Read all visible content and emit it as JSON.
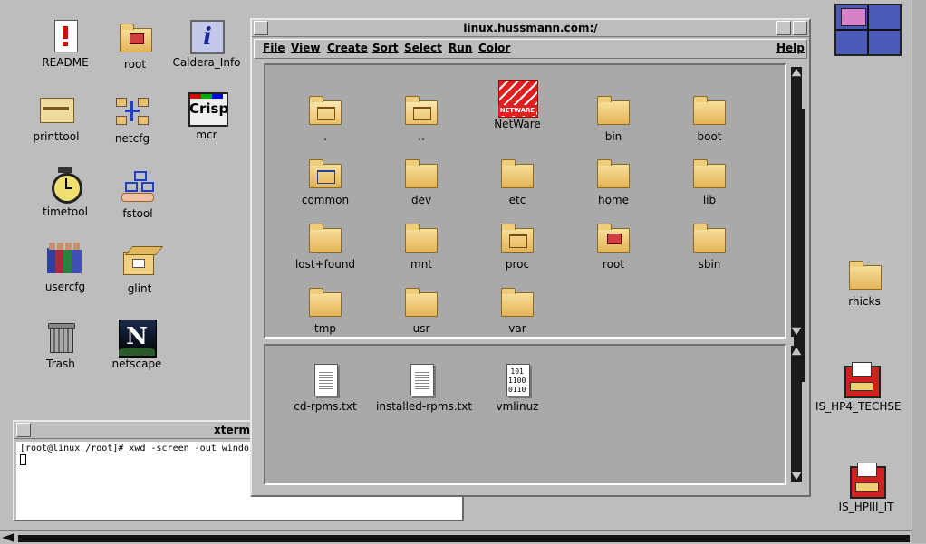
{
  "desktop_icons": [
    {
      "label": "README",
      "icon": "readme-doc-icon"
    },
    {
      "label": "root",
      "icon": "home-folder-icon"
    },
    {
      "label": "Caldera_Info",
      "icon": "info-icon"
    },
    {
      "label": "printtool",
      "icon": "printer-icon"
    },
    {
      "label": "netcfg",
      "icon": "network-icon"
    },
    {
      "label": "mcr",
      "icon": "crisp-icon"
    },
    {
      "label": "timetool",
      "icon": "stopwatch-icon"
    },
    {
      "label": "fstool",
      "icon": "filesystem-icon"
    },
    {
      "label": "usercfg",
      "icon": "users-icon"
    },
    {
      "label": "glint",
      "icon": "package-icon"
    },
    {
      "label": "Trash",
      "icon": "trash-icon"
    },
    {
      "label": "netscape",
      "icon": "netscape-icon"
    }
  ],
  "right_icons": [
    {
      "label": "rhicks",
      "icon": "folder-icon"
    },
    {
      "label": "IS_HP4_TECHSE",
      "icon": "printer-queue-icon"
    },
    {
      "label": "IS_HPIII_IT",
      "icon": "printer-queue-icon"
    }
  ],
  "crisp_text": "Crisp",
  "netscape_letter": "N",
  "info_letter": "i",
  "file_manager": {
    "title": "linux.hussmann.com:/",
    "menus": [
      "File",
      "View",
      "Create",
      "Sort",
      "Select",
      "Run",
      "Color"
    ],
    "help": "Help",
    "folders": [
      ".",
      "..",
      "NetWare",
      "bin",
      "boot",
      "common",
      "dev",
      "etc",
      "home",
      "lib",
      "lost+found",
      "mnt",
      "proc",
      "root",
      "sbin",
      "tmp",
      "usr",
      "var"
    ],
    "netware_text": "NETWARE",
    "files": [
      {
        "label": "cd-rpms.txt",
        "type": "text"
      },
      {
        "label": "installed-rpms.txt",
        "type": "text"
      },
      {
        "label": "vmlinuz",
        "type": "binary"
      }
    ],
    "binary_digits": [
      "101",
      "1100",
      "0110"
    ]
  },
  "xterm": {
    "title": "xterm",
    "command_line": "[root@linux /root]# xwd -screen -out windo"
  }
}
